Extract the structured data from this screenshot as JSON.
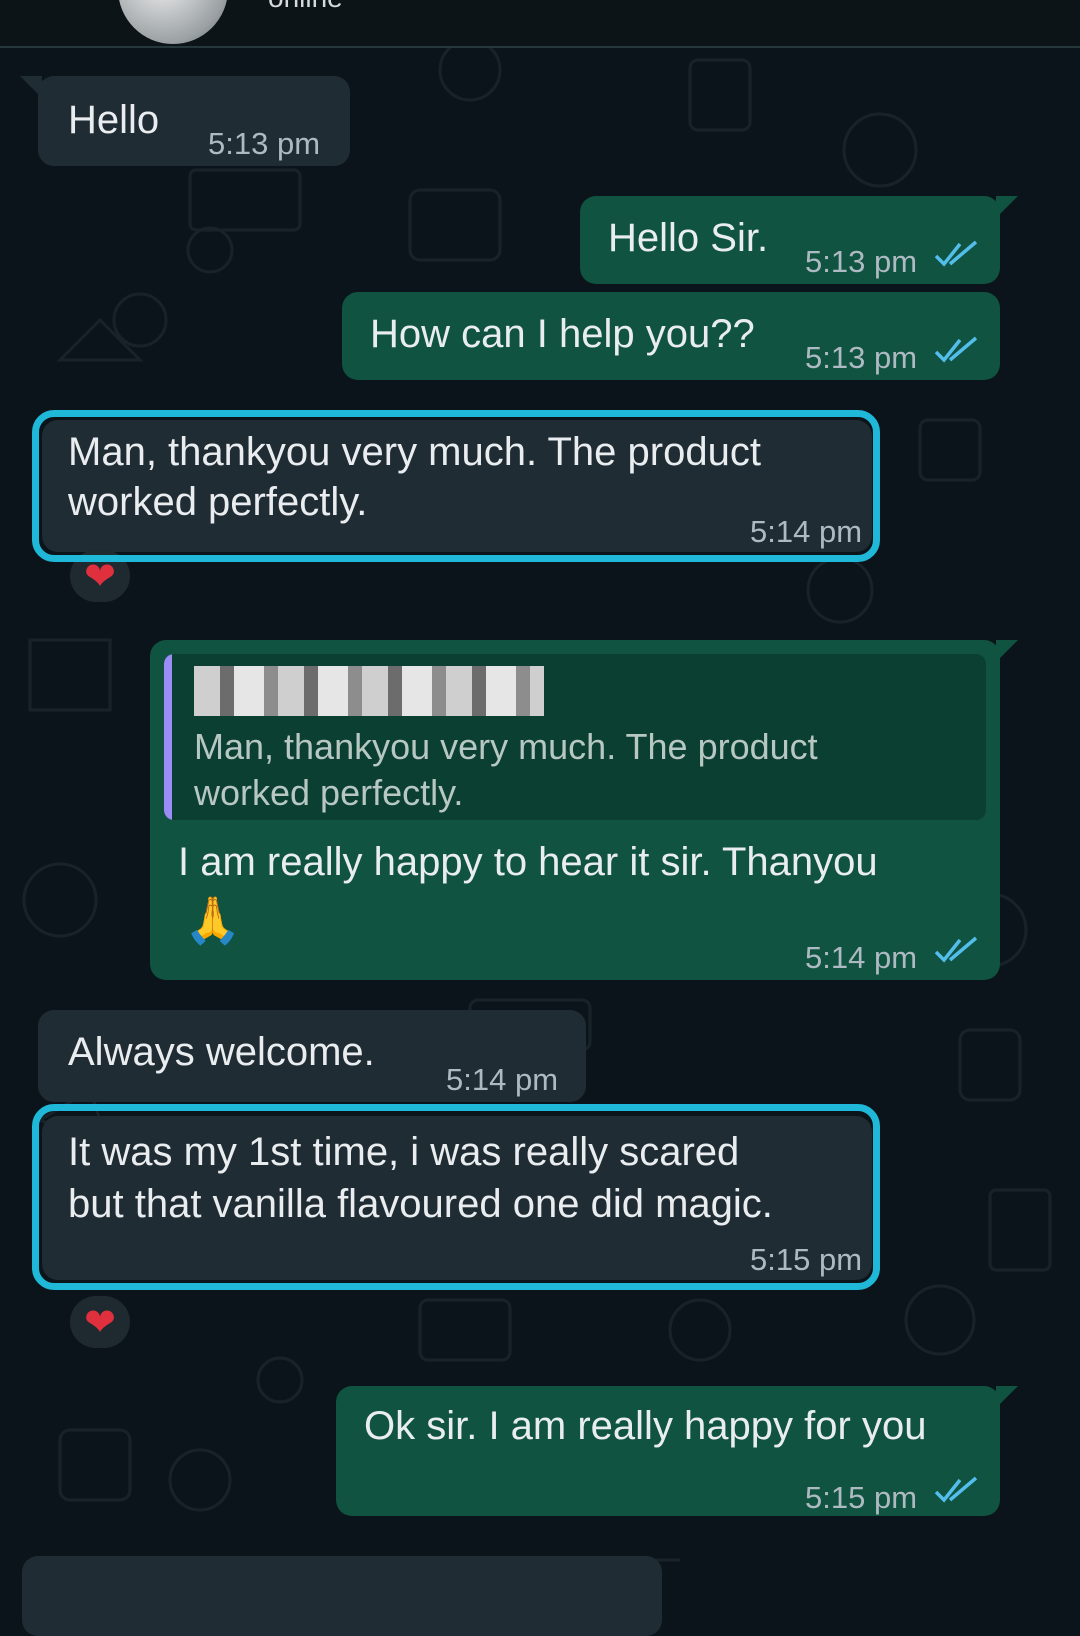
{
  "header": {
    "status": "online"
  },
  "messages": [
    {
      "id": "m1",
      "direction": "in",
      "text": "Hello",
      "time": "5:13 pm"
    },
    {
      "id": "m2",
      "direction": "out",
      "text": "Hello Sir.",
      "time": "5:13 pm",
      "read": true
    },
    {
      "id": "m3",
      "direction": "out",
      "text": "How can I help you??",
      "time": "5:13 pm",
      "read": true
    },
    {
      "id": "m4",
      "direction": "in",
      "line1": "Man, thankyou very much. The product",
      "line2": "worked perfectly.",
      "time": "5:14 pm",
      "reaction": "❤",
      "highlighted": true
    },
    {
      "id": "m5",
      "direction": "out",
      "quote": "Man, thankyou very much. The product\nworked perfectly.",
      "text": "I am really happy to hear it sir. Thanyou",
      "emoji": "🙏",
      "time": "5:14 pm",
      "read": true
    },
    {
      "id": "m6",
      "direction": "in",
      "text": "Always welcome.",
      "time": "5:14 pm"
    },
    {
      "id": "m7",
      "direction": "in",
      "line1": "It was my 1st time, i was really scared",
      "line2": "but that vanilla flavoured one did magic.",
      "time": "5:15 pm",
      "reaction": "❤",
      "highlighted": true
    },
    {
      "id": "m8",
      "direction": "out",
      "text": "Ok sir. I am really happy for you",
      "time": "5:15 pm",
      "read": true
    }
  ],
  "colors": {
    "incoming": "#202c33",
    "outgoing": "#0f5340",
    "highlight": "#1fb8d8",
    "read_ticks": "#53bdeb"
  }
}
